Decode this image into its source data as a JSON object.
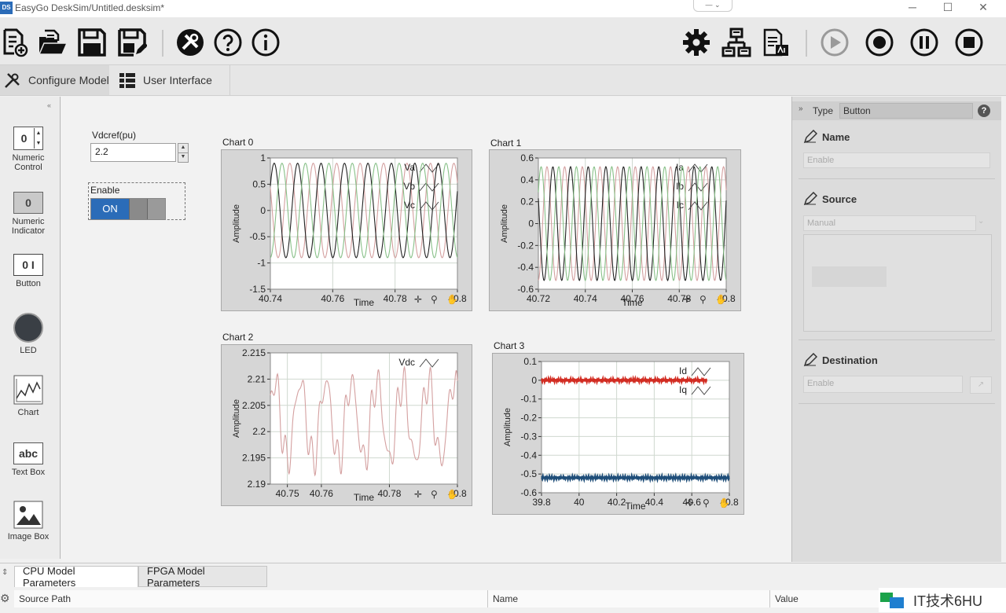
{
  "window": {
    "title": "EasyGo DeskSim/Untitled.desksim*",
    "logo": "DS"
  },
  "tabs": [
    {
      "label": "Configure Model"
    },
    {
      "label": "User Interface"
    }
  ],
  "palette": [
    {
      "label": "Numeric Control",
      "glyph": "0"
    },
    {
      "label": "Numeric Indicator",
      "glyph": "0"
    },
    {
      "label": "Button",
      "glyph": "0 I"
    },
    {
      "label": "LED"
    },
    {
      "label": "Chart"
    },
    {
      "label": "Text Box",
      "glyph": "abc"
    },
    {
      "label": "Image Box"
    }
  ],
  "canvas": {
    "numeric": {
      "label": "Vdcref(pu)",
      "value": "2.2"
    },
    "button": {
      "label": "Enable",
      "state": "ON"
    }
  },
  "charts": {
    "chart0": {
      "title": "Chart 0",
      "chart_data": {
        "type": "line",
        "title": "Chart 0",
        "xlabel": "Time",
        "ylabel": "Amplitude",
        "xlim": [
          40.74,
          40.8
        ],
        "ylim": [
          -1.5,
          1
        ],
        "xticks": [
          "40.74",
          "40.76",
          "40.78",
          "40.8"
        ],
        "yticks": [
          "1",
          "0.5",
          "0",
          "-0.5",
          "-1",
          "-1.5"
        ],
        "series": [
          {
            "name": "Va",
            "amplitude": 0.9,
            "phase_deg": 0,
            "frequency_hz": 133
          },
          {
            "name": "Vb",
            "amplitude": 0.9,
            "phase_deg": -120,
            "frequency_hz": 133
          },
          {
            "name": "Vc",
            "amplitude": 0.9,
            "phase_deg": 120,
            "frequency_hz": 133
          }
        ],
        "grid": true,
        "legend": "top-right"
      }
    },
    "chart1": {
      "title": "Chart 1",
      "chart_data": {
        "type": "line",
        "title": "Chart 1",
        "xlabel": "Time",
        "ylabel": "Amplitude",
        "xlim": [
          40.72,
          40.8
        ],
        "ylim": [
          -0.6,
          0.6
        ],
        "xticks": [
          "40.72",
          "40.74",
          "40.76",
          "40.78",
          "40.8"
        ],
        "yticks": [
          "0.6",
          "0.4",
          "0.2",
          "0",
          "-0.2",
          "-0.4",
          "-0.6"
        ],
        "series": [
          {
            "name": "Ia",
            "amplitude": 0.52,
            "phase_deg": 0,
            "frequency_hz": 133
          },
          {
            "name": "Ib",
            "amplitude": 0.52,
            "phase_deg": -120,
            "frequency_hz": 133
          },
          {
            "name": "Ic",
            "amplitude": 0.52,
            "phase_deg": 120,
            "frequency_hz": 133
          }
        ],
        "grid": true,
        "legend": "top-right"
      }
    },
    "chart2": {
      "title": "Chart 2",
      "chart_data": {
        "type": "line",
        "title": "Chart 2",
        "xlabel": "Time",
        "ylabel": "Amplitude",
        "xlim": [
          40.745,
          40.8
        ],
        "ylim": [
          2.19,
          2.215
        ],
        "xticks": [
          "40.75",
          "40.76",
          "40.78",
          "40.8"
        ],
        "yticks": [
          "2.215",
          "2.21",
          "2.205",
          "2.2",
          "2.195",
          "2.19"
        ],
        "series": [
          {
            "name": "Vdc",
            "mean": 2.202,
            "amplitude": 0.0075,
            "frequency_hz": 133
          }
        ],
        "grid": true,
        "legend": "top-right"
      }
    },
    "chart3": {
      "title": "Chart 3",
      "chart_data": {
        "type": "line",
        "title": "Chart 3",
        "xlabel": "Time",
        "ylabel": "Amplitude",
        "xlim": [
          39.8,
          40.8
        ],
        "ylim": [
          -0.6,
          0.1
        ],
        "xticks": [
          "39.8",
          "40",
          "40.2",
          "40.4",
          "40.6",
          "40.8"
        ],
        "yticks": [
          "0.1",
          "0",
          "-0.1",
          "-0.2",
          "-0.3",
          "-0.4",
          "-0.5",
          "-0.6"
        ],
        "series": [
          {
            "name": "Id",
            "value": 0.0,
            "x_end": 40.68,
            "color": "#d22c22"
          },
          {
            "name": "Iq",
            "value": -0.52,
            "color": "#1f4e79"
          }
        ],
        "grid": true,
        "legend": "top-right"
      }
    }
  },
  "colors": {
    "phase_a": "#d4a0a0",
    "phase_b": "#222222",
    "phase_c": "#88c088",
    "accent": "#2b6cb8"
  },
  "right_panel": {
    "type_label": "Type",
    "type_value": "Button",
    "name_label": "Name",
    "name_value": "Enable",
    "source_label": "Source",
    "source_value": "Manual",
    "destination_label": "Destination",
    "destination_value": "Enable"
  },
  "bottom": {
    "tabs": [
      "CPU Model Parameters",
      "FPGA Model Parameters"
    ],
    "columns": [
      "Source Path",
      "Name",
      "Value"
    ]
  },
  "watermark": "IT技术6HU"
}
